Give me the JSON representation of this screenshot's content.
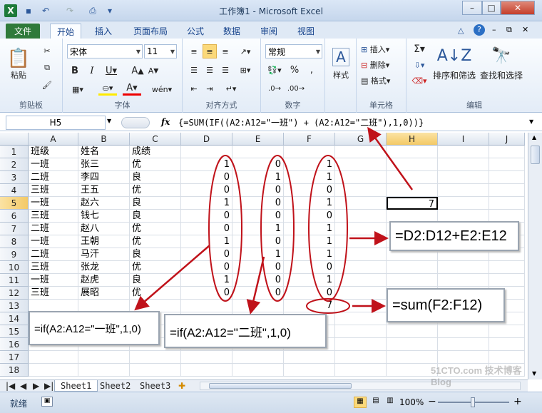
{
  "window": {
    "title": "工作簿1 - Microsoft Excel",
    "minimize": "–",
    "maximize": "□",
    "close": "✕"
  },
  "ribbon_tabs": [
    "文件",
    "开始",
    "插入",
    "页面布局",
    "公式",
    "数据",
    "审阅",
    "视图"
  ],
  "ribbon": {
    "paste": "粘贴",
    "clipboard": "剪贴板",
    "font_name": "宋体",
    "font_size": "11",
    "font_group": "字体",
    "align_group": "对齐方式",
    "number_format": "常规",
    "number_group": "数字",
    "style": "样式",
    "insert": "插入",
    "delete": "删除",
    "format": "格式",
    "cells_group": "单元格",
    "sort_filter": "排序和筛选",
    "find_select": "查找和选择",
    "edit_group": "编辑"
  },
  "formula_bar": {
    "name_box": "H5",
    "fx": "fx",
    "formula": "{=SUM(IF((A2:A12=\"一班\") + (A2:A12=\"二班\"),1,0))}"
  },
  "columns": [
    "A",
    "B",
    "C",
    "D",
    "E",
    "F",
    "G",
    "H",
    "I",
    "J"
  ],
  "rows": [
    [
      "班级",
      "姓名",
      "成绩",
      "",
      "",
      ""
    ],
    [
      "一班",
      "张三",
      "优",
      "1",
      "0",
      "1"
    ],
    [
      "二班",
      "李四",
      "良",
      "0",
      "1",
      "1"
    ],
    [
      "三班",
      "王五",
      "优",
      "0",
      "0",
      "0"
    ],
    [
      "一班",
      "赵六",
      "良",
      "1",
      "0",
      "1"
    ],
    [
      "三班",
      "钱七",
      "良",
      "0",
      "0",
      "0"
    ],
    [
      "二班",
      "赵八",
      "优",
      "0",
      "1",
      "1"
    ],
    [
      "一班",
      "王朝",
      "优",
      "1",
      "0",
      "1"
    ],
    [
      "二班",
      "马汗",
      "良",
      "0",
      "1",
      "1"
    ],
    [
      "三班",
      "张龙",
      "优",
      "0",
      "0",
      "0"
    ],
    [
      "一班",
      "赵虎",
      "良",
      "1",
      "0",
      "1"
    ],
    [
      "三班",
      "展昭",
      "优",
      "0",
      "0",
      "0"
    ],
    [
      "",
      "",
      "",
      "",
      "",
      "7"
    ],
    [
      "",
      "",
      "",
      "",
      "",
      ""
    ],
    [
      "",
      "",
      "",
      "",
      "",
      ""
    ],
    [
      "",
      "",
      "",
      "",
      "",
      ""
    ],
    [
      "",
      "",
      "",
      "",
      "",
      ""
    ],
    [
      "",
      "",
      "",
      "",
      "",
      ""
    ]
  ],
  "row_numbers": [
    "1",
    "2",
    "3",
    "4",
    "5",
    "6",
    "7",
    "8",
    "9",
    "10",
    "11",
    "12",
    "13",
    "14",
    "15",
    "16",
    "17",
    "18"
  ],
  "h5_value": "7",
  "annotations": {
    "d_formula": "=if(A2:A12=\"一班\",1,0)",
    "e_formula": "=if(A2:A12=\"二班\",1,0)",
    "f_formula": "=D2:D12+E2:E12",
    "sum_formula": "=sum(F2:F12)"
  },
  "sheets": [
    "Sheet1",
    "Sheet2",
    "Sheet3"
  ],
  "status": {
    "ready": "就绪",
    "zoom": "100%",
    "zoom_minus": "−",
    "zoom_plus": "+"
  },
  "watermark": "51CTO.com 技术博客 Blog",
  "colors": {
    "arrow": "#c0121a",
    "oval": "#c0121a",
    "file_tab": "#2f7a3a",
    "selection": "#f5cf6b"
  }
}
